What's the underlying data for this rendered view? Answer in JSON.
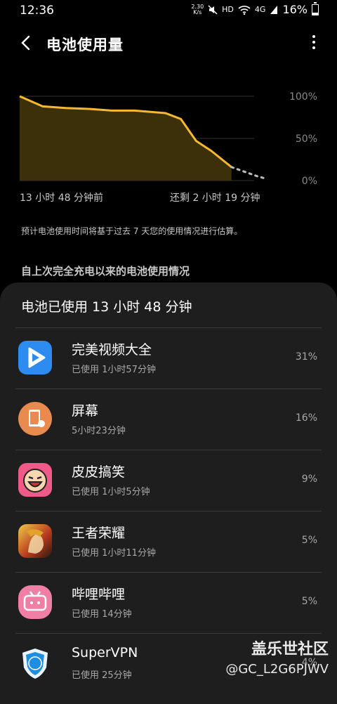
{
  "status_bar": {
    "time": "12:36",
    "net_speed_top": "2.30",
    "net_speed_bottom": "K/s",
    "hd": "HD",
    "signal": "4G",
    "battery": "16%"
  },
  "header": {
    "title": "电池使用量"
  },
  "chart": {
    "y_labels": [
      "100%",
      "50%",
      "0%"
    ],
    "x_start": "13 小时 48 分钟前",
    "x_end": "还剩 2 小时 19 分钟",
    "accent": "#f5b82e"
  },
  "chart_data": {
    "type": "area",
    "x_unit": "hours",
    "x": [
      0,
      1.5,
      3,
      4.5,
      6,
      7.5,
      9.5,
      10.5,
      11.5,
      12.5,
      13.8,
      15.5,
      16.1
    ],
    "values": [
      100,
      88,
      86,
      85,
      83,
      83,
      80,
      73,
      47,
      35,
      16,
      5,
      2
    ],
    "projected_from_x": 13.8,
    "ylim": [
      0,
      100
    ]
  },
  "note": "预计电池使用时间将基于过去 7 天您的使用情况进行估算。",
  "since_label": "自上次完全充电以来的电池使用情况",
  "sheet": {
    "total_used": "电池已使用 13 小时 48 分钟",
    "apps": [
      {
        "name": "完美视频大全",
        "usage": "已使用 1小时57分钟",
        "pct": "31%",
        "icon": "video-play-icon",
        "color": "#2e8bf0"
      },
      {
        "name": "屏幕",
        "usage": "5小时23分钟",
        "pct": "16%",
        "icon": "screen-icon",
        "color": "#e98a4e"
      },
      {
        "name": "皮皮搞笑",
        "usage": "已使用 1小时5分钟",
        "pct": "9%",
        "icon": "laughing-face-icon",
        "color": "#ee5b88"
      },
      {
        "name": "王者荣耀",
        "usage": "已使用 1小时11分钟",
        "pct": "5%",
        "icon": "game-hero-icon",
        "color": "#c89a2e"
      },
      {
        "name": "哔哩哔哩",
        "usage": "已使用 14分钟",
        "pct": "5%",
        "icon": "bilibili-icon",
        "color": "#f07fa6"
      },
      {
        "name": "SuperVPN",
        "usage": "已使用 25分钟",
        "pct": "4%",
        "icon": "shield-vpn-icon",
        "color": "#1e8fe0"
      }
    ]
  },
  "watermark": {
    "line1": "盖乐世社区",
    "line2": "@GC_L2G6PJWV"
  }
}
